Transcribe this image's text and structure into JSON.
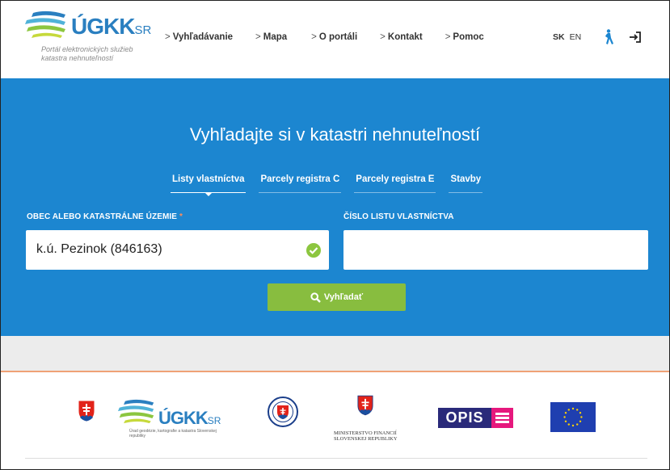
{
  "header": {
    "logo_text": "ÚGKK",
    "logo_suffix": "SR",
    "logo_subtitle": "Portál elektronických služieb katastra nehnuteľností",
    "nav": [
      {
        "label": "Vyhľadávanie"
      },
      {
        "label": "Mapa"
      },
      {
        "label": "O portáli"
      },
      {
        "label": "Kontakt"
      },
      {
        "label": "Pomoc"
      }
    ],
    "languages": [
      "SK",
      "EN"
    ],
    "active_language": "SK"
  },
  "hero": {
    "title": "Vyhľadajte si v katastri nehnuteľností",
    "tabs": [
      {
        "label": "Listy vlastníctva",
        "active": true
      },
      {
        "label": "Parcely registra C",
        "active": false
      },
      {
        "label": "Parcely registra E",
        "active": false
      },
      {
        "label": "Stavby",
        "active": false
      }
    ],
    "fields": {
      "territory": {
        "label": "OBEC ALEBO KATASTRÁLNE ÚZEMIE",
        "required_mark": "*",
        "value": "k.ú. Pezinok (846163)"
      },
      "ownership": {
        "label": "ČÍSLO LISTU VLASTNÍCTVA",
        "value": ""
      }
    },
    "search_button": "Vyhľadať"
  },
  "partners": {
    "ugkk_logo_text": "ÚGKK",
    "ugkk_logo_suffix": "SR",
    "ugkk_subtitle": "Úrad geodézie, kartografie a katastra Slovenskej republiky",
    "mf_line1": "MINISTERSTVO FINANCIÍ",
    "mf_line2": "SLOVENSKEJ REPUBLIKY",
    "opis_text": "OPIS"
  },
  "colors": {
    "hero_bg": "#1c86d0",
    "button": "#88bd3f",
    "accent_line": "#f0a276",
    "logo_blue": "#2a7fc0"
  }
}
